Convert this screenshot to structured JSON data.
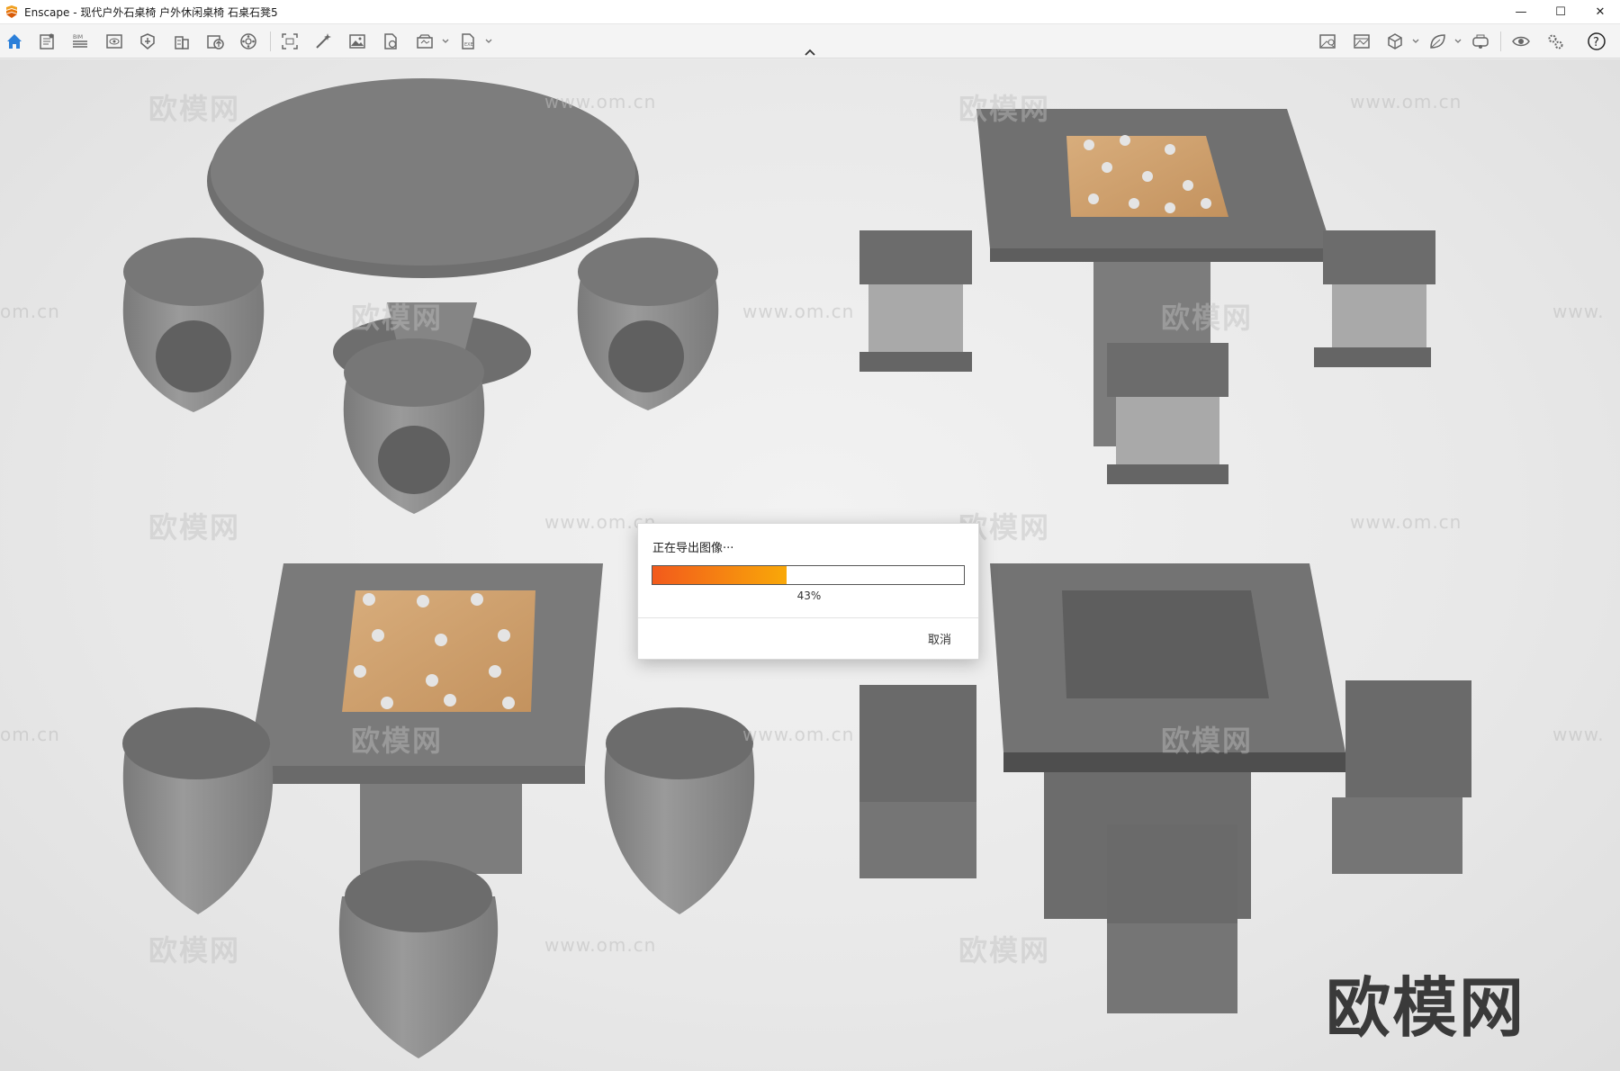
{
  "window": {
    "title": "Enscape - 现代户外石桌椅 户外休闲桌椅 石桌石凳5",
    "controls": {
      "minimize": "—",
      "maximize": "☐",
      "close": "✕"
    }
  },
  "toolbar": {
    "accent_color": "#2b7fd9",
    "bim_label": "BIM",
    "left_icons": [
      "home-icon",
      "document-icon",
      "bim-list-icon",
      "view-icon",
      "asset-library-icon",
      "building-icon",
      "upload-icon",
      "material-icon",
      "screenshot-icon",
      "magic-wand-icon",
      "image-icon",
      "file-export-icon",
      "batch-render-icon",
      "export-icon"
    ],
    "right_icons": [
      "visual-settings-icon",
      "image-render-icon",
      "cube-icon",
      "leaf-icon",
      "vr-headset-icon",
      "eye-icon",
      "settings-icon",
      "help-icon"
    ]
  },
  "viewport": {
    "watermark_text": "欧模网",
    "watermark_url": "www.om.cn",
    "watermark_url_partial": "om.cn",
    "watermark_url_edge": "www.",
    "brand_watermark": "欧模网"
  },
  "dialog": {
    "title": "正在导出图像···",
    "progress_percent": 43,
    "progress_label": "43%",
    "cancel_label": "取消",
    "progress_colors": [
      "#f25a1c",
      "#f9a808"
    ]
  }
}
